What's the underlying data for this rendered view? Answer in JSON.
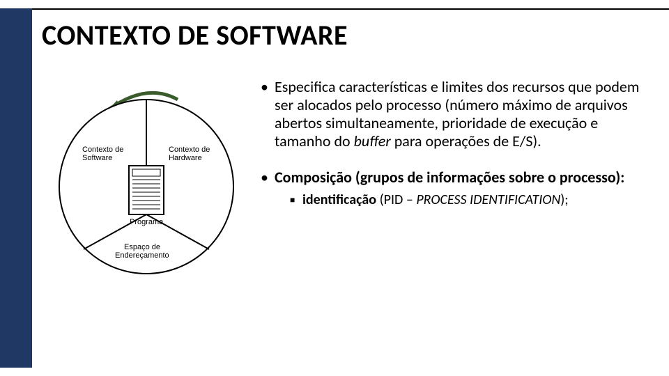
{
  "title": "CONTEXTO DE SOFTWARE",
  "bullets": {
    "b1_pre": "Especifica características e limites dos recursos que podem ser alocados pelo processo (número máximo de arquivos abertos simultaneamente, prioridade de execução e tamanho do ",
    "b1_buffer": "buffer",
    "b1_post": " para operações de E/S).",
    "b2": "Composição (grupos de informações sobre o processo):",
    "b2a_bold": "identificação",
    "b2a_mid": " (PID – ",
    "b2a_ital": "PROCESS IDENTIFICATION",
    "b2a_post": ");"
  },
  "diagram": {
    "sw": "Contexto de\nSoftware",
    "hw": "Contexto de\nHardware",
    "prog": "Programa",
    "addr": "Espaço de\nEndereçamento"
  }
}
